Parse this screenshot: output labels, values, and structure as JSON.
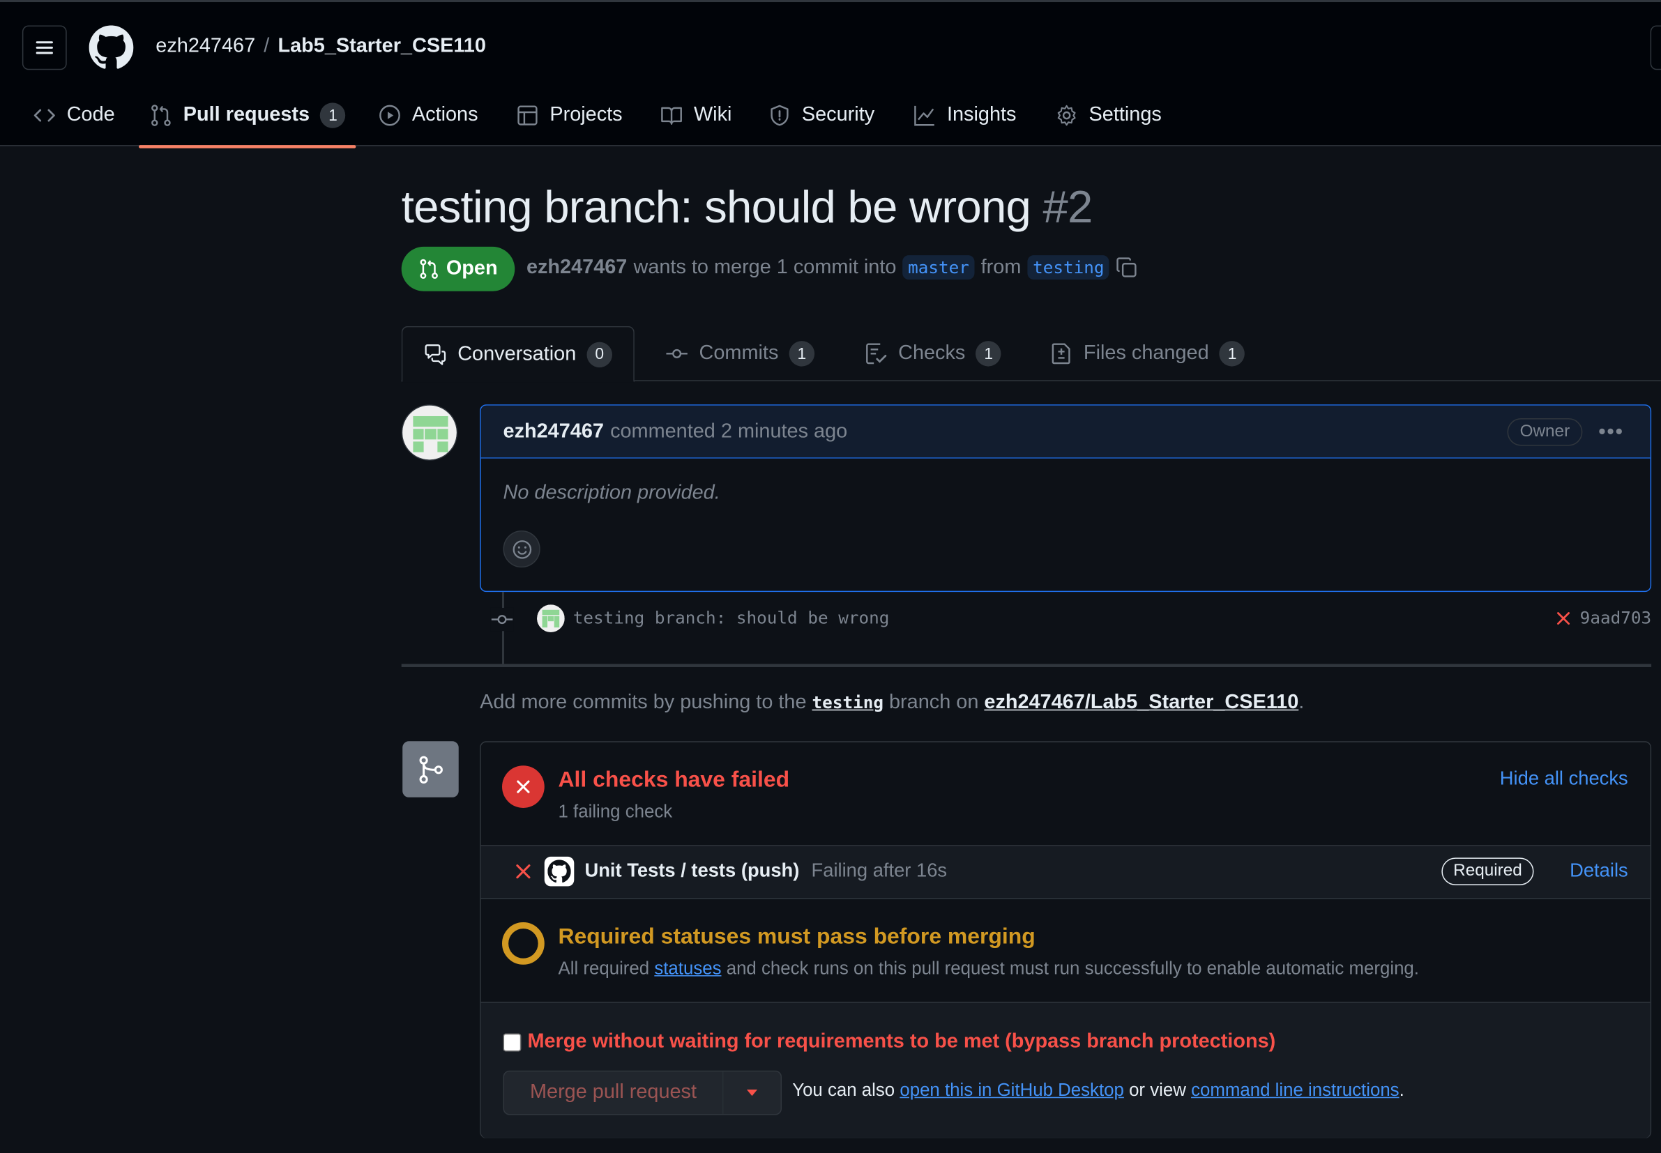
{
  "repo": {
    "owner": "ezh247467",
    "separator": "/",
    "name": "Lab5_Starter_CSE110"
  },
  "nav": {
    "code": "Code",
    "pulls": "Pull requests",
    "pulls_count": "1",
    "actions": "Actions",
    "projects": "Projects",
    "wiki": "Wiki",
    "security": "Security",
    "insights": "Insights",
    "settings": "Settings"
  },
  "pr": {
    "title": "testing branch: should be wrong",
    "number": "#2",
    "state": "Open",
    "author": "ezh247467",
    "merge_text": "wants to merge 1 commit into",
    "base": "master",
    "from_text": "from",
    "head": "testing"
  },
  "tabs": {
    "conversation": "Conversation",
    "conversation_count": "0",
    "commits": "Commits",
    "commits_count": "1",
    "checks": "Checks",
    "checks_count": "1",
    "files": "Files changed",
    "files_count": "1"
  },
  "comment": {
    "author": "ezh247467",
    "action": "commented 2 minutes ago",
    "badge": "Owner",
    "body": "No description provided."
  },
  "commit": {
    "message": "testing branch: should be wrong",
    "sha": "9aad703"
  },
  "hint": {
    "prefix": "Add more commits by pushing to the",
    "branch": "testing",
    "middle": "branch on",
    "repo": "ezh247467/Lab5_Starter_CSE110",
    "suffix": "."
  },
  "checks": {
    "title": "All checks have failed",
    "subtitle": "1 failing check",
    "hide": "Hide all checks",
    "item_name": "Unit Tests / tests (push)",
    "item_status": "Failing after 16s",
    "item_badge": "Required",
    "item_details": "Details"
  },
  "required": {
    "title": "Required statuses must pass before merging",
    "prefix": "All required",
    "link": "statuses",
    "suffix": "and check runs on this pull request must run successfully to enable automatic merging."
  },
  "merge": {
    "bypass": "Merge without waiting for requirements to be met (bypass branch protections)",
    "button": "Merge pull request",
    "also_prefix": "You can also",
    "desktop_link": "open this in GitHub Desktop",
    "or_view": "or view",
    "cli_link": "command line instructions",
    "period": "."
  },
  "colors": {
    "bg": "#0d1117",
    "header_bg": "#010409",
    "open_green": "#238636",
    "fail_red": "#f85149",
    "pending_yellow": "#d29922",
    "link_blue": "#4493f8",
    "tab_underline": "#f78166"
  }
}
